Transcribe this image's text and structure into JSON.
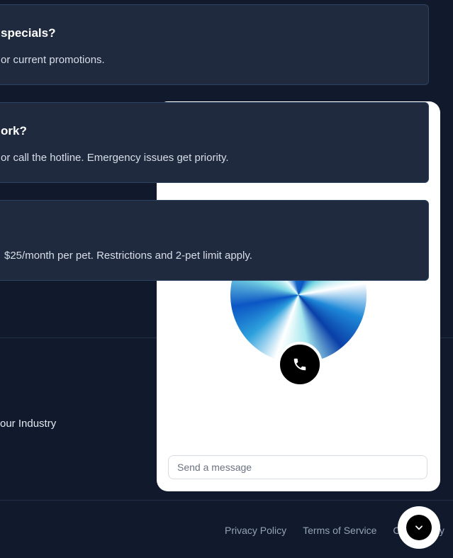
{
  "faq": [
    {
      "question": "specials?",
      "answer": "or current promotions."
    },
    {
      "question": "ork?",
      "answer": "or call the hotline. Emergency issues get priority."
    },
    {
      "question": "",
      "answer": "$25/month per pet. Restrictions and 2-pet limit apply."
    }
  ],
  "footer": {
    "industry_link": "our Industry",
    "links": [
      "Privacy Policy",
      "Terms of Service",
      "Co",
      "ty"
    ]
  },
  "chat": {
    "placeholder": "Send a message",
    "call_icon": "phone-icon",
    "toggle_icon": "chevron-down-icon"
  },
  "colors": {
    "background": "#111a2c",
    "card": "#1f2a3e",
    "card_border": "#2c4461",
    "chat_panel": "#ffffff",
    "footer_link": "#94a3b8"
  }
}
